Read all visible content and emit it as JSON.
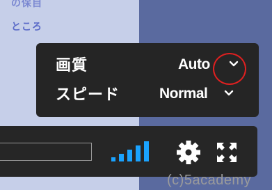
{
  "background": {
    "line1": "の保自",
    "line2": "ところ"
  },
  "settings_menu": {
    "quality": {
      "label": "画質",
      "value": "Auto"
    },
    "speed": {
      "label": "スピード",
      "value": "Normal"
    }
  },
  "controls": {
    "icons": [
      "volume-bars-icon",
      "gear-icon",
      "fullscreen-icon"
    ],
    "accent_color": "#1aa3ff"
  },
  "watermark": "(c)5academy",
  "colors": {
    "menu_bg": "#252525",
    "highlight_ring": "#e02020",
    "volume_bars": "#1aa3ff"
  }
}
